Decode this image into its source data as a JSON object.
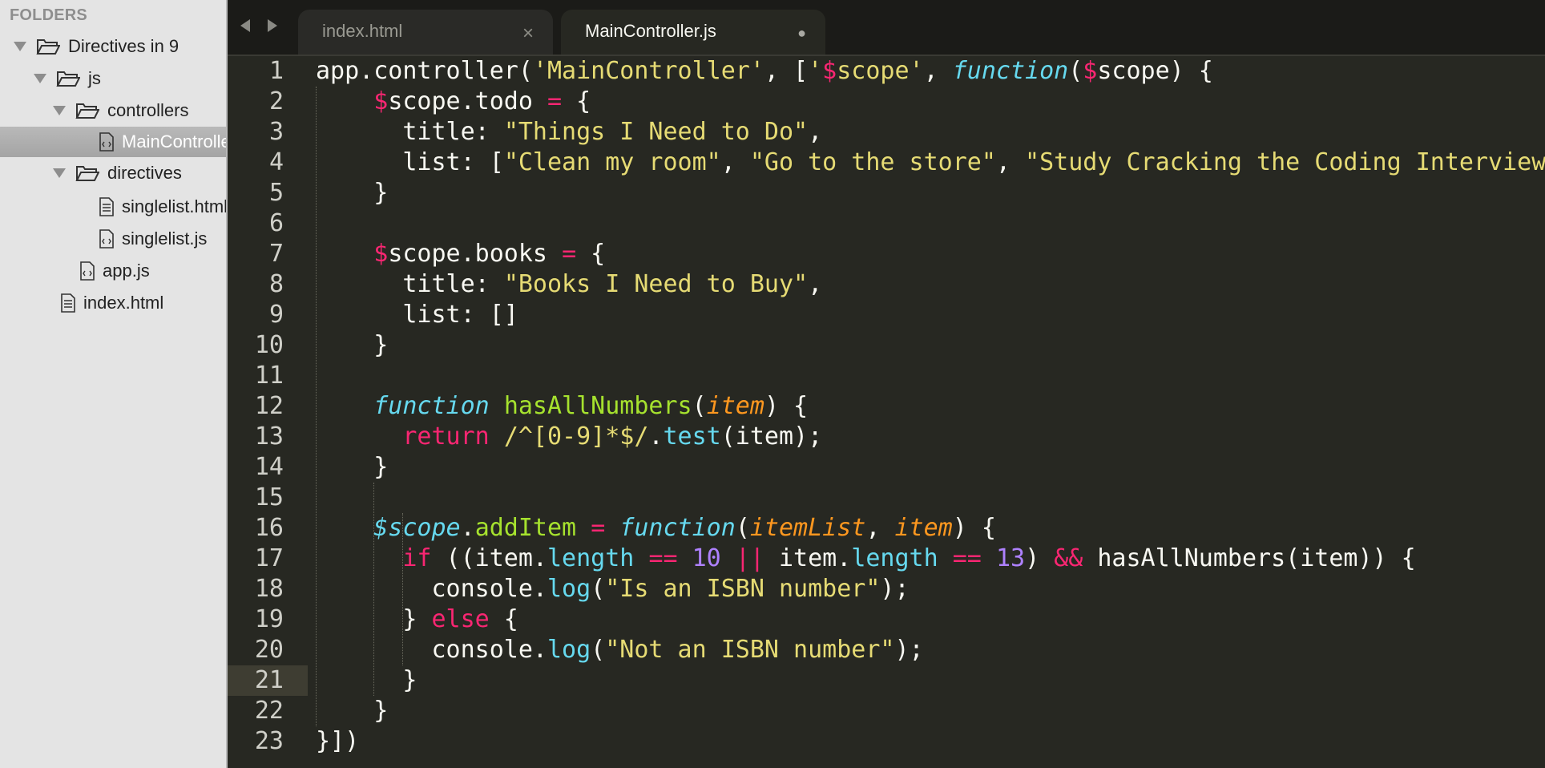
{
  "sidebar": {
    "header": "FOLDERS",
    "items": [
      {
        "label": "Directives in 9",
        "type": "folder"
      },
      {
        "label": "js",
        "type": "folder"
      },
      {
        "label": "controllers",
        "type": "folder"
      },
      {
        "label": "MainController.js",
        "type": "file",
        "selected": true
      },
      {
        "label": "directives",
        "type": "folder"
      },
      {
        "label": "singlelist.html",
        "type": "file"
      },
      {
        "label": "singlelist.js",
        "type": "file"
      },
      {
        "label": "app.js",
        "type": "file"
      },
      {
        "label": "index.html",
        "type": "file"
      }
    ]
  },
  "tabs": [
    {
      "label": "index.html",
      "control": "×",
      "active": false
    },
    {
      "label": "MainController.js",
      "control": "●",
      "active": true
    }
  ],
  "editor": {
    "current_line": 21,
    "line_numbers": [
      "1",
      "2",
      "3",
      "4",
      "5",
      "6",
      "7",
      "8",
      "9",
      "10",
      "11",
      "12",
      "13",
      "14",
      "15",
      "16",
      "17",
      "18",
      "19",
      "20",
      "21",
      "22",
      "23"
    ],
    "lines": [
      [
        [
          "w",
          "app.controller("
        ],
        [
          "s",
          "'MainController'"
        ],
        [
          "w",
          ", ["
        ],
        [
          "s",
          "'"
        ],
        [
          "k",
          "$"
        ],
        [
          "s",
          "scope'"
        ],
        [
          "w",
          ", "
        ],
        [
          "fi",
          "function"
        ],
        [
          "w",
          "("
        ],
        [
          "k",
          "$"
        ],
        [
          "w",
          "scope) {"
        ]
      ],
      [
        [
          "w",
          "    "
        ],
        [
          "k",
          "$"
        ],
        [
          "w",
          "scope.todo "
        ],
        [
          "k",
          "="
        ],
        [
          "w",
          " {"
        ]
      ],
      [
        [
          "w",
          "      title: "
        ],
        [
          "s",
          "\"Things I Need to Do\""
        ],
        [
          "w",
          ","
        ]
      ],
      [
        [
          "w",
          "      list: ["
        ],
        [
          "s",
          "\"Clean my room\""
        ],
        [
          "w",
          ", "
        ],
        [
          "s",
          "\"Go to the store\""
        ],
        [
          "w",
          ", "
        ],
        [
          "s",
          "\"Study Cracking the Coding Interview\""
        ]
      ],
      [
        [
          "w",
          "    }"
        ]
      ],
      [
        [
          "w",
          ""
        ]
      ],
      [
        [
          "w",
          "    "
        ],
        [
          "k",
          "$"
        ],
        [
          "w",
          "scope.books "
        ],
        [
          "k",
          "="
        ],
        [
          "w",
          " {"
        ]
      ],
      [
        [
          "w",
          "      title: "
        ],
        [
          "s",
          "\"Books I Need to Buy\""
        ],
        [
          "w",
          ","
        ]
      ],
      [
        [
          "w",
          "      list: []"
        ]
      ],
      [
        [
          "w",
          "    }"
        ]
      ],
      [
        [
          "w",
          ""
        ]
      ],
      [
        [
          "w",
          "    "
        ],
        [
          "fi",
          "function"
        ],
        [
          "w",
          " "
        ],
        [
          "f",
          "hasAllNumbers"
        ],
        [
          "w",
          "("
        ],
        [
          "p",
          "item"
        ],
        [
          "w",
          ") {"
        ]
      ],
      [
        [
          "w",
          "      "
        ],
        [
          "k",
          "return"
        ],
        [
          "w",
          " "
        ],
        [
          "s",
          "/^[0-9]*$/"
        ],
        [
          "w",
          "."
        ],
        [
          "b",
          "test"
        ],
        [
          "w",
          "(item);"
        ]
      ],
      [
        [
          "w",
          "    }"
        ]
      ],
      [
        [
          "w",
          ""
        ]
      ],
      [
        [
          "w",
          "    "
        ],
        [
          "fi",
          "$scope"
        ],
        [
          "w",
          "."
        ],
        [
          "f",
          "addItem"
        ],
        [
          "w",
          " "
        ],
        [
          "k",
          "="
        ],
        [
          "w",
          " "
        ],
        [
          "fi",
          "function"
        ],
        [
          "w",
          "("
        ],
        [
          "p",
          "itemList"
        ],
        [
          "w",
          ", "
        ],
        [
          "p",
          "item"
        ],
        [
          "w",
          ") {"
        ]
      ],
      [
        [
          "w",
          "      "
        ],
        [
          "k",
          "if"
        ],
        [
          "w",
          " ((item."
        ],
        [
          "b",
          "length"
        ],
        [
          "w",
          " "
        ],
        [
          "k",
          "=="
        ],
        [
          "w",
          " "
        ],
        [
          "n",
          "10"
        ],
        [
          "w",
          " "
        ],
        [
          "k",
          "||"
        ],
        [
          "w",
          " item."
        ],
        [
          "b",
          "length"
        ],
        [
          "w",
          " "
        ],
        [
          "k",
          "=="
        ],
        [
          "w",
          " "
        ],
        [
          "n",
          "13"
        ],
        [
          "w",
          ") "
        ],
        [
          "k",
          "&&"
        ],
        [
          "w",
          " hasAllNumbers(item)) {"
        ]
      ],
      [
        [
          "w",
          "        console."
        ],
        [
          "b",
          "log"
        ],
        [
          "w",
          "("
        ],
        [
          "s",
          "\"Is an ISBN number\""
        ],
        [
          "w",
          ");"
        ]
      ],
      [
        [
          "w",
          "      } "
        ],
        [
          "k",
          "else"
        ],
        [
          "w",
          " {"
        ]
      ],
      [
        [
          "w",
          "        console."
        ],
        [
          "b",
          "log"
        ],
        [
          "w",
          "("
        ],
        [
          "s",
          "\"Not an ISBN number\""
        ],
        [
          "w",
          ");"
        ]
      ],
      [
        [
          "w",
          "      }"
        ]
      ],
      [
        [
          "w",
          "    }"
        ]
      ],
      [
        [
          "w",
          "}])"
        ]
      ]
    ]
  }
}
